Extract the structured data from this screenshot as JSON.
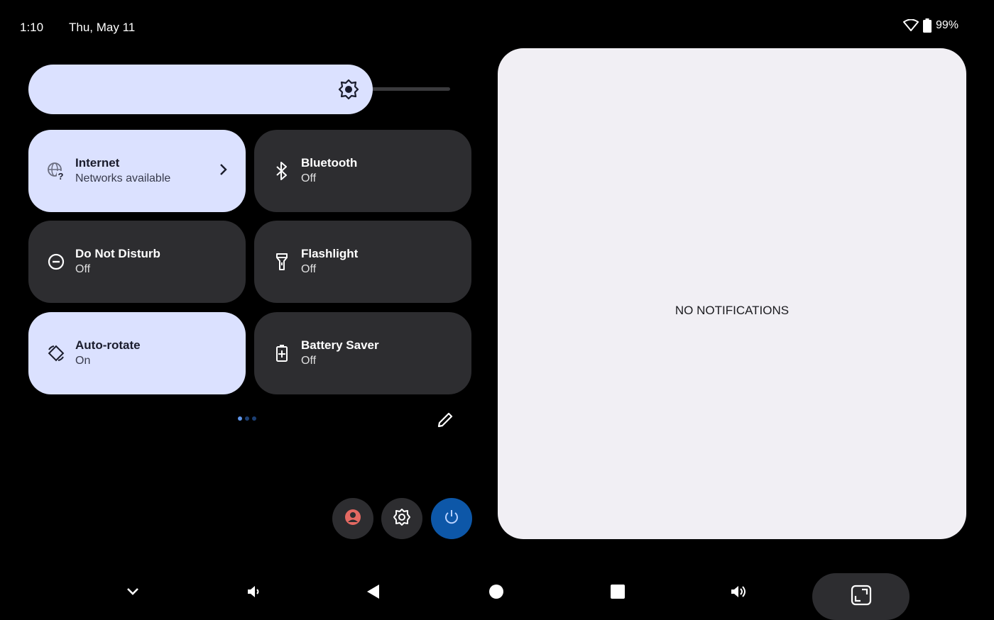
{
  "status_bar": {
    "time": "1:10",
    "date": "Thu, May 11",
    "battery": "99%",
    "icons": [
      "wifi-icon",
      "battery-icon"
    ]
  },
  "brightness": {
    "level": 0.78,
    "icon": "brightness-icon"
  },
  "tiles": [
    {
      "label": "Internet",
      "status": "Networks available",
      "state": "on",
      "icon": "globe-question-icon",
      "has_chevron": true
    },
    {
      "label": "Bluetooth",
      "status": "Off",
      "state": "off",
      "icon": "bluetooth-icon"
    },
    {
      "label": "Do Not Disturb",
      "status": "Off",
      "state": "off",
      "icon": "do-not-disturb-icon"
    },
    {
      "label": "Flashlight",
      "status": "Off",
      "state": "off",
      "icon": "flashlight-icon"
    },
    {
      "label": "Auto-rotate",
      "status": "On",
      "state": "on",
      "icon": "auto-rotate-icon"
    },
    {
      "label": "Battery Saver",
      "status": "Off",
      "state": "off",
      "icon": "battery-saver-icon"
    }
  ],
  "pager": {
    "pages": 3,
    "current": 1
  },
  "notifications": {
    "empty_text": "NO NOTIFICATIONS"
  },
  "colors": {
    "tile_on": "#dbe1ff",
    "tile_off": "#2d2d30",
    "power_button": "#0d57a8",
    "user_icon": "#e46962",
    "notification_panel": "#f1eff4"
  }
}
